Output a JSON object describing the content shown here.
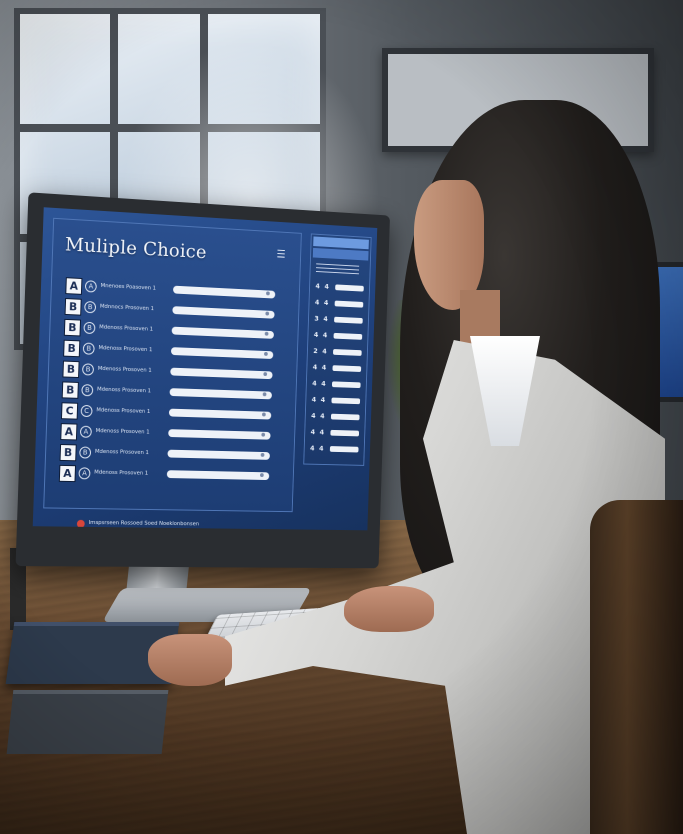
{
  "screen": {
    "title": "Muliple Choice",
    "questions": [
      {
        "letter": "A",
        "radio": "A",
        "text": "Mnenoes Poasoven 1"
      },
      {
        "letter": "B",
        "radio": "B",
        "text": "Mdnnocs Prosoven 1"
      },
      {
        "letter": "B",
        "radio": "B",
        "text": "Mdenoss Prosoven 1"
      },
      {
        "letter": "B",
        "radio": "B",
        "text": "Mdenoss Prosoven 1"
      },
      {
        "letter": "B",
        "radio": "B",
        "text": "Mdenoss Prosoven 1"
      },
      {
        "letter": "B",
        "radio": "B",
        "text": "Mdenoss Prosoven 1"
      },
      {
        "letter": "C",
        "radio": "C",
        "text": "Mdenoss Prosoven 1"
      },
      {
        "letter": "A",
        "radio": "A",
        "text": "Mdenoss Prosoven 1"
      },
      {
        "letter": "B",
        "radio": "B",
        "text": "Mdenoss Prosoven 1"
      },
      {
        "letter": "A",
        "radio": "A",
        "text": "Mdenoss Prosoven 1"
      }
    ],
    "footer_text": "Imspsrseen Rossoed Soed Noeklonbonsen",
    "sidebar_rows": [
      {
        "a": "4",
        "b": "4"
      },
      {
        "a": "4",
        "b": "4"
      },
      {
        "a": "3",
        "b": "4"
      },
      {
        "a": "4",
        "b": "4"
      },
      {
        "a": "2",
        "b": "4"
      },
      {
        "a": "4",
        "b": "4"
      },
      {
        "a": "4",
        "b": "4"
      },
      {
        "a": "4",
        "b": "4"
      },
      {
        "a": "4",
        "b": "4"
      },
      {
        "a": "4",
        "b": "4"
      },
      {
        "a": "4",
        "b": "4"
      }
    ],
    "colors": {
      "screen": "#1e3f7a",
      "accent": "#6d9be0",
      "alert": "#d8463b"
    }
  }
}
